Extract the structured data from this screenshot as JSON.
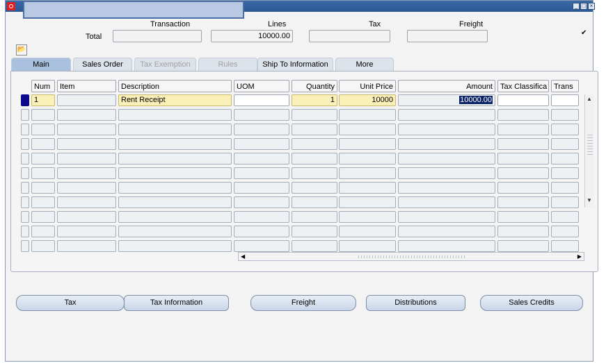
{
  "window": {
    "title": ""
  },
  "header": {
    "columns": [
      {
        "label": "Transaction",
        "value": ""
      },
      {
        "label": "Lines",
        "value": "10000.00"
      },
      {
        "label": "Tax",
        "value": ""
      },
      {
        "label": "Freight",
        "value": ""
      }
    ],
    "total_label": "Total",
    "checkbox_checked": true,
    "checkbox_glyph": "✔"
  },
  "tabs": [
    {
      "label": "Main",
      "state": "active"
    },
    {
      "label": "Sales Order",
      "state": "normal"
    },
    {
      "label": "Tax Exemption",
      "state": "disabled"
    },
    {
      "label": "Rules",
      "state": "disabled"
    },
    {
      "label": "Ship To Information",
      "state": "normal"
    },
    {
      "label": "More",
      "state": "normal"
    }
  ],
  "grid": {
    "columns": [
      "Num",
      "Item",
      "Description",
      "UOM",
      "Quantity",
      "Unit Price",
      "Amount",
      "Tax Classifica",
      "Trans"
    ],
    "rows": [
      [
        "1",
        "",
        "Rent Receipt",
        "",
        "1",
        "10000",
        "10000.00",
        "",
        ""
      ],
      [
        "",
        "",
        "",
        "",
        "",
        "",
        "",
        "",
        ""
      ],
      [
        "",
        "",
        "",
        "",
        "",
        "",
        "",
        "",
        ""
      ],
      [
        "",
        "",
        "",
        "",
        "",
        "",
        "",
        "",
        ""
      ],
      [
        "",
        "",
        "",
        "",
        "",
        "",
        "",
        "",
        ""
      ],
      [
        "",
        "",
        "",
        "",
        "",
        "",
        "",
        "",
        ""
      ],
      [
        "",
        "",
        "",
        "",
        "",
        "",
        "",
        "",
        ""
      ],
      [
        "",
        "",
        "",
        "",
        "",
        "",
        "",
        "",
        ""
      ],
      [
        "",
        "",
        "",
        "",
        "",
        "",
        "",
        "",
        ""
      ],
      [
        "",
        "",
        "",
        "",
        "",
        "",
        "",
        "",
        ""
      ],
      [
        "",
        "",
        "",
        "",
        "",
        "",
        "",
        "",
        ""
      ]
    ]
  },
  "buttons": [
    {
      "label": "Tax",
      "mnemonic": "x"
    },
    {
      "label": "Tax Information",
      "mnemonic": "a"
    },
    {
      "label": "Freight",
      "mnemonic": "F"
    },
    {
      "label": "Distributions",
      "mnemonic": "D"
    },
    {
      "label": "Sales Credits",
      "mnemonic": "S"
    }
  ],
  "colors": {
    "titlebar": "#2b5894",
    "active_tab": "#a9c0de",
    "required_field": "#fbf0b8",
    "current_row": "#0a0a8a"
  }
}
